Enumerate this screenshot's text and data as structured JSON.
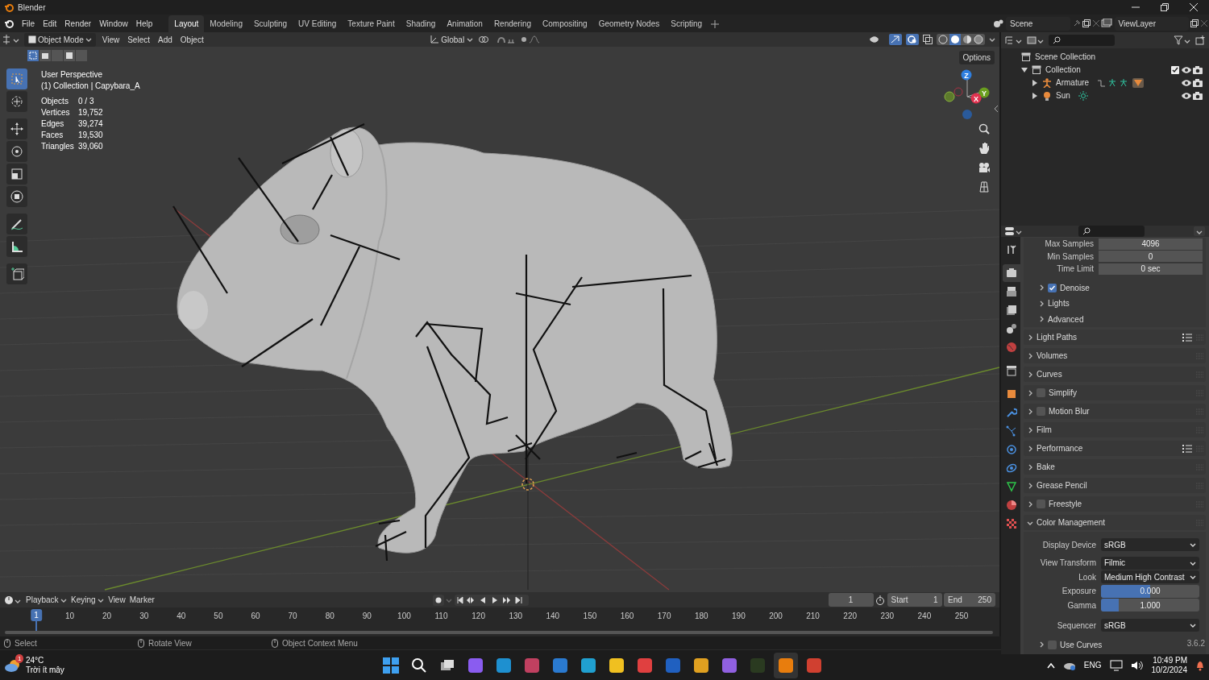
{
  "window": {
    "title": "Blender"
  },
  "menu": [
    "File",
    "Edit",
    "Render",
    "Window",
    "Help"
  ],
  "workspaces": [
    {
      "label": "Layout",
      "selected": true
    },
    {
      "label": "Modeling",
      "selected": false
    },
    {
      "label": "Sculpting",
      "selected": false
    },
    {
      "label": "UV Editing",
      "selected": false
    },
    {
      "label": "Texture Paint",
      "selected": false
    },
    {
      "label": "Shading",
      "selected": false
    },
    {
      "label": "Animation",
      "selected": false
    },
    {
      "label": "Rendering",
      "selected": false
    },
    {
      "label": "Compositing",
      "selected": false
    },
    {
      "label": "Geometry Nodes",
      "selected": false
    },
    {
      "label": "Scripting",
      "selected": false
    }
  ],
  "scene": {
    "name": "Scene",
    "view_layer": "ViewLayer"
  },
  "viewport": {
    "mode": "Object Mode",
    "menus": [
      "View",
      "Select",
      "Add",
      "Object"
    ],
    "orientation": "Global",
    "options": "Options",
    "view_name": "User Perspective",
    "collection": "(1) Collection | Capybara_A",
    "stats": [
      {
        "label": "Objects",
        "value": "0 / 3"
      },
      {
        "label": "Vertices",
        "value": "19,752"
      },
      {
        "label": "Edges",
        "value": "39,274"
      },
      {
        "label": "Faces",
        "value": "19,530"
      },
      {
        "label": "Triangles",
        "value": "39,060"
      }
    ],
    "gizmo_axes": [
      "Z",
      "Y",
      "X"
    ],
    "tools": [
      {
        "selected": true
      },
      {
        "selected": false
      },
      {
        "selected": false
      },
      {
        "selected": false
      },
      {
        "selected": false
      },
      {
        "selected": false
      },
      {
        "selected": false
      },
      {
        "selected": false
      },
      {
        "selected": false
      }
    ]
  },
  "outliner": {
    "items": [
      {
        "label": "Scene Collection",
        "children": [
          {
            "label": "Collection",
            "expanded": true,
            "checked": true,
            "children": [
              {
                "label": "Armature",
                "expanded": false
              },
              {
                "label": "Sun",
                "expanded": false
              }
            ]
          }
        ]
      }
    ]
  },
  "properties": {
    "tabs": [
      {
        "selected": false
      },
      {
        "selected": true
      },
      {
        "selected": false
      },
      {
        "selected": false
      },
      {
        "selected": false
      },
      {
        "selected": false
      },
      {
        "selected": false
      },
      {
        "selected": false
      },
      {
        "selected": false
      },
      {
        "selected": false
      },
      {
        "selected": false
      },
      {
        "selected": false
      },
      {
        "selected": false
      },
      {
        "selected": false
      },
      {
        "selected": false
      }
    ],
    "fields": [
      {
        "label": "Max Samples",
        "value": "4096"
      },
      {
        "label": "Min Samples",
        "value": "0"
      },
      {
        "label": "Time Limit",
        "value": "0 sec"
      }
    ],
    "subpanels": [
      {
        "label": "Denoise",
        "kind": "checkbox",
        "checked": true
      },
      {
        "label": "Lights",
        "kind": "plain"
      },
      {
        "label": "Advanced",
        "kind": "plain"
      }
    ],
    "panels": [
      {
        "label": "Light Paths",
        "kind": "plain",
        "presets": true,
        "expanded": false
      },
      {
        "label": "Volumes",
        "kind": "plain",
        "presets": false,
        "expanded": false
      },
      {
        "label": "Curves",
        "kind": "plain",
        "presets": false,
        "expanded": false
      },
      {
        "label": "Simplify",
        "kind": "checkbox",
        "checked": false,
        "presets": false,
        "expanded": false
      },
      {
        "label": "Motion Blur",
        "kind": "checkbox",
        "checked": false,
        "presets": false,
        "expanded": false
      },
      {
        "label": "Film",
        "kind": "plain",
        "presets": false,
        "expanded": false
      },
      {
        "label": "Performance",
        "kind": "plain",
        "presets": true,
        "expanded": false
      },
      {
        "label": "Bake",
        "kind": "plain",
        "presets": false,
        "expanded": false
      },
      {
        "label": "Grease Pencil",
        "kind": "plain",
        "presets": false,
        "expanded": false
      },
      {
        "label": "Freestyle",
        "kind": "checkbox",
        "checked": false,
        "presets": false,
        "expanded": false
      },
      {
        "label": "Color Management",
        "kind": "plain",
        "presets": false,
        "expanded": true
      }
    ],
    "color_management": [
      {
        "label": "Display Device",
        "kind": "dropdown",
        "value": "sRGB"
      },
      {
        "label": "View Transform",
        "kind": "dropdown",
        "value": "Filmic"
      },
      {
        "label": "Look",
        "kind": "dropdown",
        "value": "Medium High Contrast"
      },
      {
        "label": "Exposure",
        "kind": "slider",
        "value": "0.000",
        "level": 0.5
      },
      {
        "label": "Gamma",
        "kind": "slider",
        "value": "1.000",
        "level": 0.18
      },
      {
        "label": "Sequencer",
        "kind": "dropdown",
        "value": "sRGB"
      }
    ],
    "use_curves": {
      "label": "Use Curves",
      "checked": false
    }
  },
  "timeline": {
    "menus": [
      "Playback",
      "Keying",
      "View",
      "Marker"
    ],
    "current_frame": "1",
    "start_label": "Start",
    "start": "1",
    "end_label": "End",
    "end": "250",
    "playhead": "1",
    "ticks": [
      "10",
      "20",
      "30",
      "40",
      "50",
      "60",
      "70",
      "80",
      "90",
      "100",
      "110",
      "120",
      "130",
      "140",
      "150",
      "160",
      "170",
      "180",
      "190",
      "200",
      "210",
      "220",
      "230",
      "240",
      "250"
    ]
  },
  "status_bar": {
    "hints": [
      "Select",
      "Rotate View",
      "Object Context Menu"
    ],
    "version": "3.6.2"
  },
  "taskbar": {
    "temperature": "24°C",
    "weather": "Trời ít mây",
    "weather_badge": "1",
    "language": "ENG",
    "time": "10:49 PM",
    "date": "10/2/2024"
  }
}
